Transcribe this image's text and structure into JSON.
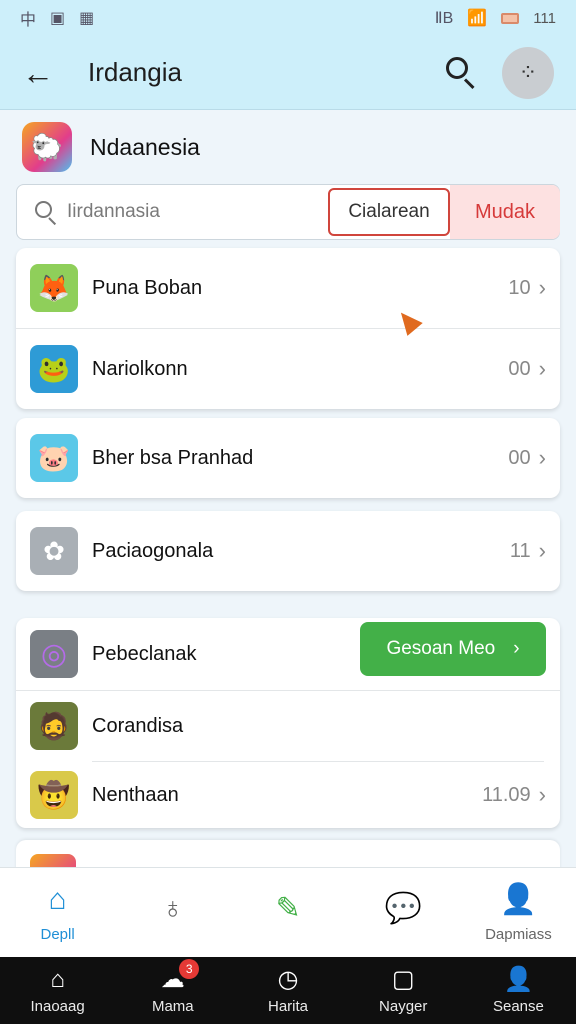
{
  "status_bar": {
    "left_icons": [
      "chinese-char-icon",
      "photo-icon",
      "gallery-icon"
    ],
    "left_glyphs": [
      "中",
      "▣",
      "▦"
    ],
    "right_glyphs": [
      "ⅡB",
      "📶"
    ],
    "time": "111"
  },
  "app_bar": {
    "title": "Irdangia",
    "back_glyph": "←",
    "more_glyph": "⁘"
  },
  "section": {
    "title": "Ndaanesia",
    "icon_glyph": "🐑"
  },
  "search": {
    "placeholder": "Iirdannasia",
    "active_pill": "Cialarean",
    "secondary_pill": "Mudak"
  },
  "card1": {
    "rows": [
      {
        "label": "Puna Boban",
        "count": "10",
        "icon": "🦊",
        "icon_bg": "#8fcf5a"
      },
      {
        "label": "Nariolkonn",
        "count": "00",
        "icon": "🐸",
        "icon_bg": "#2e9bd6"
      }
    ]
  },
  "card2": {
    "rows": [
      {
        "label": "Bher bsa Pranhad",
        "count": "00",
        "icon": "🐷",
        "icon_bg": "#5bc8e8"
      }
    ]
  },
  "card3": {
    "rows": [
      {
        "label": "Paciaogonala",
        "count": "11",
        "icon": "✿",
        "icon_bg": "#a9afb5"
      }
    ]
  },
  "card4": {
    "header": {
      "label": "Pebeclanak",
      "icon": "◎",
      "icon_bg": "#7a7f85"
    },
    "green_button": "Gesoan Meo",
    "green_button_chevron": "›",
    "rows": [
      {
        "label": "Corandisa",
        "count": "",
        "icon": "🧔",
        "icon_bg": "#6b7a3a"
      },
      {
        "label": "Nenthaan",
        "count": "11.09",
        "icon": "🤠",
        "icon_bg": "#d9c94a"
      }
    ]
  },
  "bottom_nav": [
    {
      "label": "Depll",
      "glyph": "⌂",
      "active": true
    },
    {
      "label": "",
      "glyph": "♁",
      "active": false
    },
    {
      "label": "",
      "glyph": "✎",
      "active": false
    },
    {
      "label": "",
      "glyph": "💬",
      "active": false
    },
    {
      "label": "Dapmiass",
      "glyph": "👤",
      "active": false
    }
  ],
  "system_nav": [
    {
      "label": "Inaoaag",
      "glyph": "⌂"
    },
    {
      "label": "Mama",
      "glyph": "☁",
      "badge": "3"
    },
    {
      "label": "Harita",
      "glyph": "◷"
    },
    {
      "label": "Nayger",
      "glyph": "▢"
    },
    {
      "label": "Seanse",
      "glyph": "👤"
    }
  ],
  "colors": {
    "accent": "#1f8fd6",
    "app_bar_bg": "#cdeffa",
    "green": "#43b048",
    "red": "#d63a3a"
  }
}
